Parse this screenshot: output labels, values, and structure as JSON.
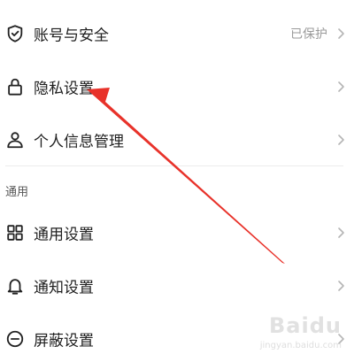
{
  "settings": {
    "items_top": [
      {
        "label": "账号与安全",
        "status": "已保护",
        "icon": "shield-check-icon"
      },
      {
        "label": "隐私设置",
        "status": "",
        "icon": "lock-icon"
      },
      {
        "label": "个人信息管理",
        "status": "",
        "icon": "person-icon"
      }
    ],
    "section_general": {
      "header": "通用",
      "items": [
        {
          "label": "通用设置",
          "icon": "grid-icon"
        },
        {
          "label": "通知设置",
          "icon": "bell-icon"
        },
        {
          "label": "屏蔽设置",
          "icon": "block-icon"
        }
      ]
    }
  },
  "annotation": {
    "arrow_color": "#e8322a",
    "points_to": "隐私设置"
  },
  "watermark": {
    "brand": "Baidu",
    "sub": "jingyan.baidu.com"
  }
}
